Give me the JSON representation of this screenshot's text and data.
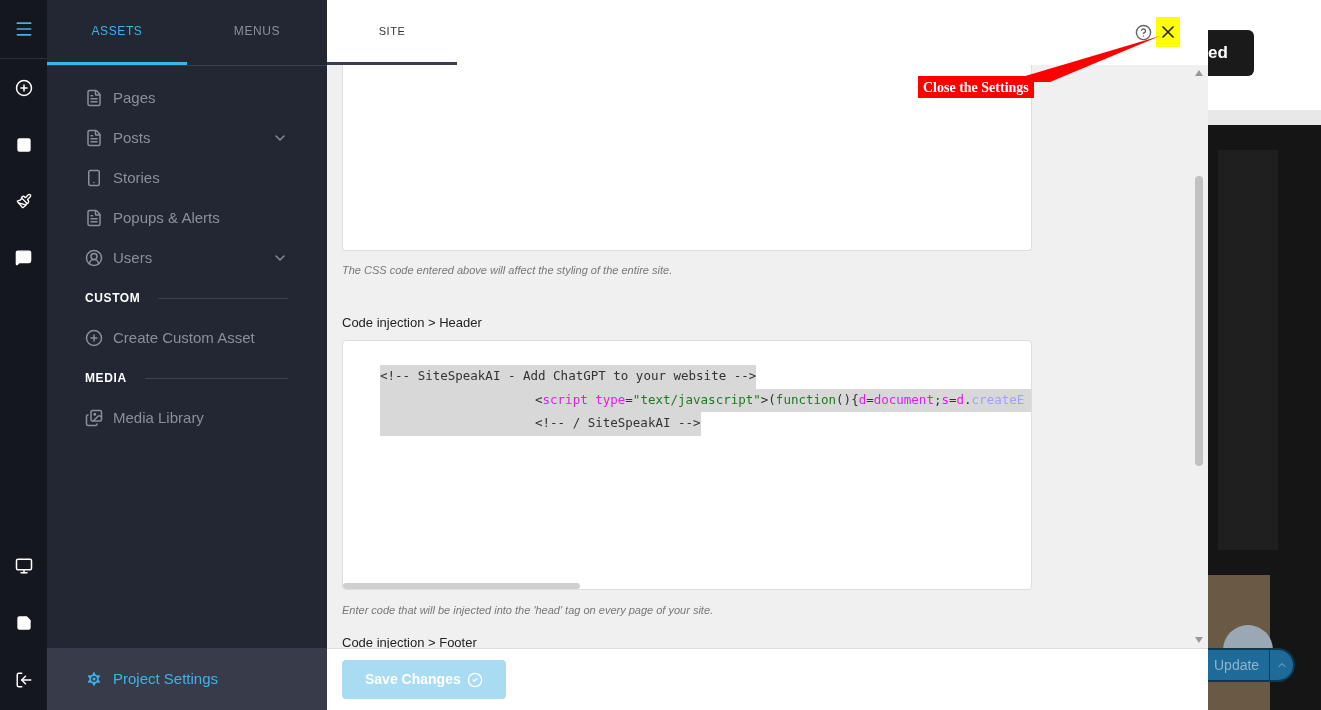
{
  "panel_tabs": [
    {
      "label": "ASSETS",
      "selected": true
    },
    {
      "label": "MENUS",
      "selected": false
    }
  ],
  "asset_groups": [
    {
      "items": [
        {
          "label": "Pages",
          "kind": "page",
          "expandable": false
        },
        {
          "label": "Posts",
          "kind": "page",
          "expandable": true
        },
        {
          "label": "Stories",
          "kind": "phone",
          "expandable": false
        },
        {
          "label": "Popups & Alerts",
          "kind": "page",
          "expandable": false
        },
        {
          "label": "Users",
          "kind": "user",
          "expandable": true
        }
      ]
    },
    {
      "heading": "CUSTOM",
      "items": [
        {
          "label": "Create Custom Asset",
          "kind": "plus",
          "expandable": false
        }
      ]
    },
    {
      "heading": "MEDIA",
      "items": [
        {
          "label": "Media Library",
          "kind": "images",
          "expandable": false
        }
      ]
    }
  ],
  "project_settings": "Project Settings",
  "settings_tabs": [
    {
      "label": "SITE",
      "selected": true
    }
  ],
  "css_hint": "The CSS code entered above will affect the styling of the entire site.",
  "header_label": "Code injection > Header",
  "header_code": [
    {
      "indented": false,
      "tokens": [
        {
          "kind": "text",
          "text": "<!-- SiteSpeakAI - Add ChatGPT to your website -->"
        }
      ]
    },
    {
      "indented": true,
      "tokens": [
        {
          "kind": "text",
          "text": "<"
        },
        {
          "kind": "keyword",
          "text": "script"
        },
        {
          "kind": "keyword",
          "text": " type"
        },
        {
          "kind": "text",
          "text": "="
        },
        {
          "kind": "string",
          "text": "\"text/javascript\""
        },
        {
          "kind": "text",
          "text": ">("
        },
        {
          "kind": "string",
          "text": "function"
        },
        {
          "kind": "text",
          "text": "(){"
        },
        {
          "kind": "keyword",
          "text": "d"
        },
        {
          "kind": "text",
          "text": "="
        },
        {
          "kind": "keyword",
          "text": "document"
        },
        {
          "kind": "text",
          "text": ";"
        },
        {
          "kind": "keyword",
          "text": "s"
        },
        {
          "kind": "text",
          "text": "="
        },
        {
          "kind": "keyword",
          "text": "d"
        },
        {
          "kind": "text",
          "text": "."
        },
        {
          "kind": "method",
          "text": "createE"
        }
      ]
    },
    {
      "indented": true,
      "tokens": [
        {
          "kind": "text",
          "text": "<!-- / SiteSpeakAI -->"
        }
      ]
    }
  ],
  "header_hint": "Enter code that will be injected into the 'head' tag on every page of your site.",
  "footer_label": "Code injection > Footer",
  "save_button": {
    "label": "Save Changes",
    "disabled": true
  },
  "callout": "Close the Settings",
  "background_page": {
    "button_fragment": "ed",
    "update_button": "Update"
  }
}
